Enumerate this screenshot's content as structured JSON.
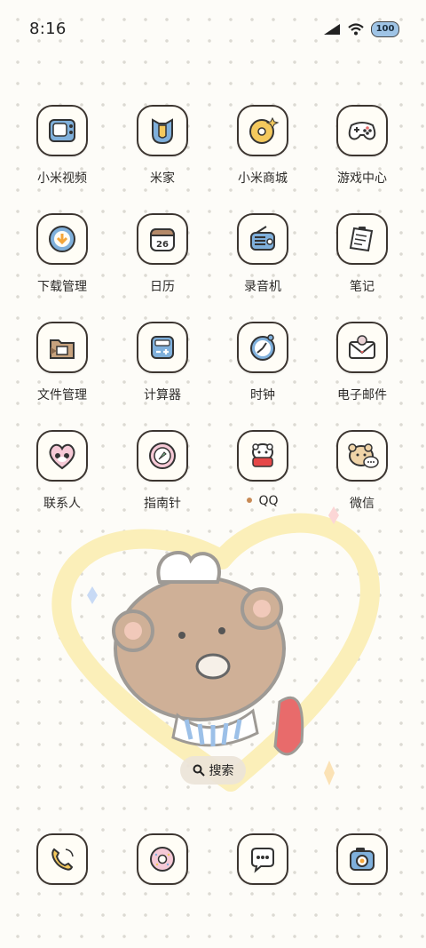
{
  "status_bar": {
    "time": "8:16",
    "battery": "100"
  },
  "apps": [
    {
      "label": "小米视频",
      "icon": "tv-icon"
    },
    {
      "label": "米家",
      "icon": "mijia-icon"
    },
    {
      "label": "小米商城",
      "icon": "donut-store-icon"
    },
    {
      "label": "游戏中心",
      "icon": "gamepad-icon"
    },
    {
      "label": "下载管理",
      "icon": "download-icon"
    },
    {
      "label": "日历",
      "icon": "calendar-icon",
      "value": "26"
    },
    {
      "label": "录音机",
      "icon": "radio-icon"
    },
    {
      "label": "笔记",
      "icon": "notepad-icon"
    },
    {
      "label": "文件管理",
      "icon": "folder-icon"
    },
    {
      "label": "计算器",
      "icon": "calculator-icon"
    },
    {
      "label": "时钟",
      "icon": "clock-icon"
    },
    {
      "label": "电子邮件",
      "icon": "mail-icon"
    },
    {
      "label": "联系人",
      "icon": "contacts-heart-icon"
    },
    {
      "label": "指南针",
      "icon": "compass-icon"
    },
    {
      "label": "QQ",
      "icon": "qq-icon",
      "badge": true
    },
    {
      "label": "微信",
      "icon": "wechat-icon"
    }
  ],
  "search": {
    "label": "搜索"
  },
  "dock": [
    {
      "icon": "phone-icon"
    },
    {
      "icon": "browser-donut-icon"
    },
    {
      "icon": "messages-icon"
    },
    {
      "icon": "camera-icon"
    }
  ],
  "colors": {
    "tile_bg": "#fffdf6",
    "tile_border": "#3c3530",
    "accent_blue": "#7fb0dc",
    "accent_yellow": "#f4c95d"
  }
}
